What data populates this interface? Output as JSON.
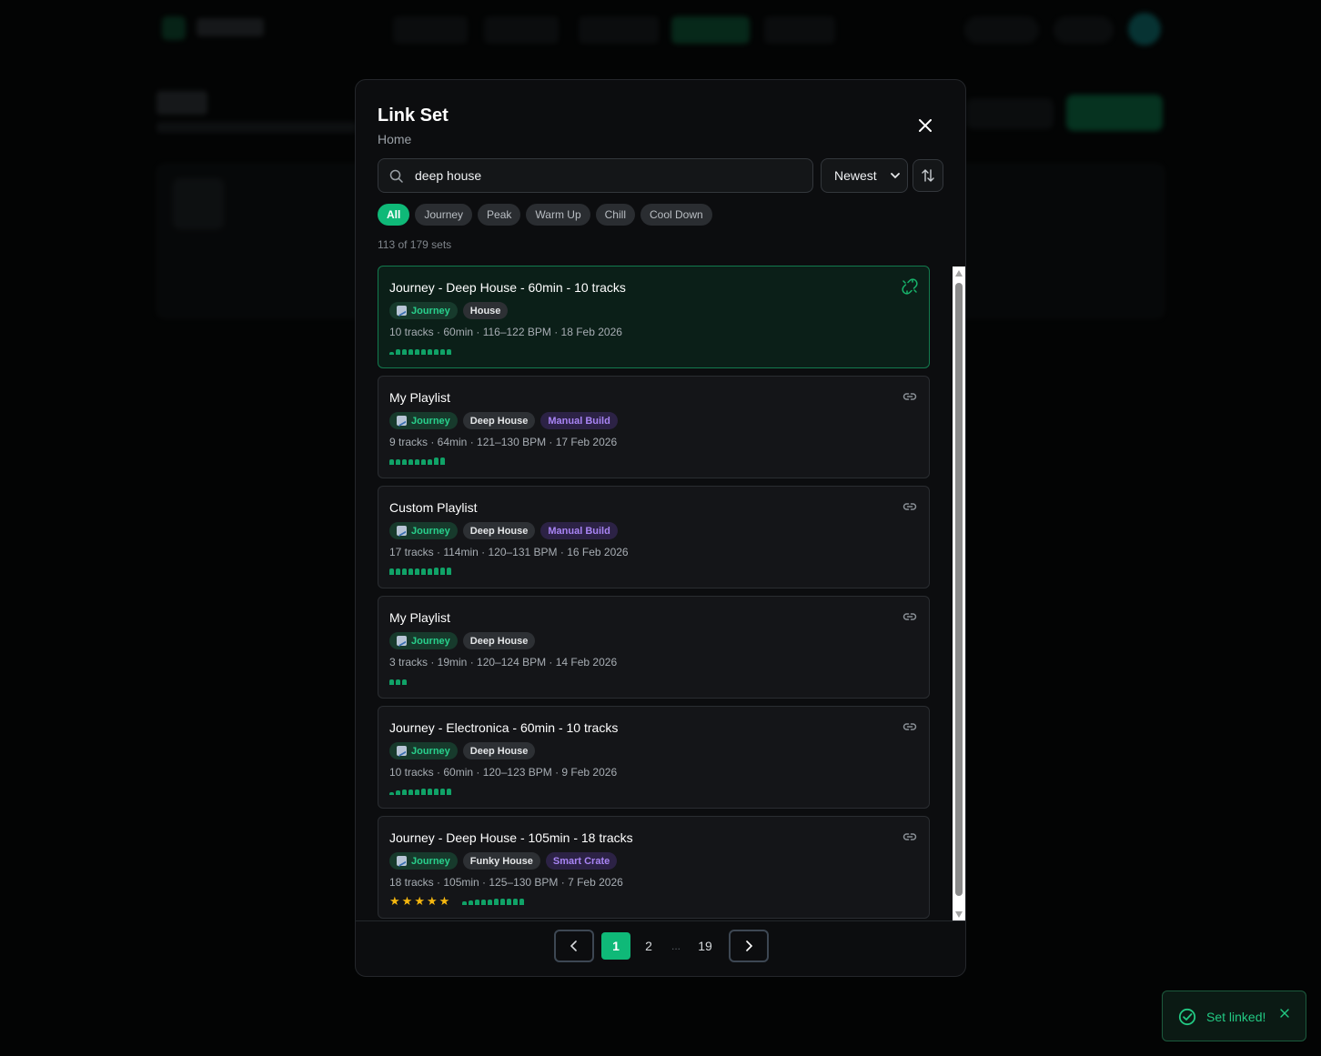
{
  "modal": {
    "title": "Link Set",
    "subtitle": "Home",
    "search": {
      "value": "deep house",
      "placeholder": ""
    },
    "sort": {
      "selected": "Newest"
    },
    "filters": [
      {
        "label": "All",
        "active": true
      },
      {
        "label": "Journey",
        "active": false
      },
      {
        "label": "Peak",
        "active": false
      },
      {
        "label": "Warm Up",
        "active": false
      },
      {
        "label": "Chill",
        "active": false
      },
      {
        "label": "Cool Down",
        "active": false
      }
    ],
    "count_text": "113 of 179 sets",
    "sets": [
      {
        "title": "Journey - Deep House - 60min - 10 tracks",
        "linked": true,
        "tags": [
          {
            "label": "Journey",
            "kind": "journey"
          },
          {
            "label": "House",
            "kind": "genre"
          }
        ],
        "meta": "10 tracks · 60min · 116–122 BPM · 18 Feb 2026",
        "energy": [
          0.3,
          0.6,
          0.6,
          0.6,
          0.6,
          0.6,
          0.6,
          0.6,
          0.6,
          0.6
        ],
        "rating": 0
      },
      {
        "title": "My Playlist",
        "linked": false,
        "tags": [
          {
            "label": "Journey",
            "kind": "journey"
          },
          {
            "label": "Deep House",
            "kind": "genre"
          },
          {
            "label": "Manual Build",
            "kind": "manual"
          }
        ],
        "meta": "9 tracks · 64min · 121–130 BPM · 17 Feb 2026",
        "energy": [
          0.6,
          0.6,
          0.6,
          0.6,
          0.6,
          0.6,
          0.6,
          0.8,
          0.8
        ],
        "rating": 0
      },
      {
        "title": "Custom Playlist",
        "linked": false,
        "tags": [
          {
            "label": "Journey",
            "kind": "journey"
          },
          {
            "label": "Deep House",
            "kind": "genre"
          },
          {
            "label": "Manual Build",
            "kind": "manual"
          }
        ],
        "meta": "17 tracks · 114min · 120–131 BPM · 16 Feb 2026",
        "energy": [
          0.7,
          0.7,
          0.7,
          0.7,
          0.7,
          0.7,
          0.7,
          0.8,
          0.8,
          0.8
        ],
        "rating": 0
      },
      {
        "title": "My Playlist",
        "linked": false,
        "tags": [
          {
            "label": "Journey",
            "kind": "journey"
          },
          {
            "label": "Deep House",
            "kind": "genre"
          }
        ],
        "meta": "3 tracks · 19min · 120–124 BPM · 14 Feb 2026",
        "energy": [
          0.6,
          0.6,
          0.6
        ],
        "rating": 0
      },
      {
        "title": "Journey - Electronica - 60min - 10 tracks",
        "linked": false,
        "tags": [
          {
            "label": "Journey",
            "kind": "journey"
          },
          {
            "label": "Deep House",
            "kind": "genre"
          }
        ],
        "meta": "10 tracks · 60min · 120–123 BPM · 9 Feb 2026",
        "energy": [
          0.3,
          0.5,
          0.6,
          0.6,
          0.6,
          0.7,
          0.7,
          0.7,
          0.7,
          0.7
        ],
        "rating": 0
      },
      {
        "title": "Journey - Deep House - 105min - 18 tracks",
        "linked": false,
        "tags": [
          {
            "label": "Journey",
            "kind": "journey"
          },
          {
            "label": "Funky House",
            "kind": "genre"
          },
          {
            "label": "Smart Crate",
            "kind": "smart"
          }
        ],
        "meta": "18 tracks · 105min · 125–130 BPM · 7 Feb 2026",
        "energy": [
          0.4,
          0.5,
          0.6,
          0.6,
          0.6,
          0.7,
          0.7,
          0.7,
          0.7,
          0.7
        ],
        "rating": 5
      }
    ],
    "pagination": {
      "pages": [
        "1",
        "2",
        "...",
        "19"
      ],
      "current": "1"
    }
  },
  "toast": {
    "text": "Set linked!"
  },
  "colors": {
    "accent": "#0fb978",
    "journey": "#28d08c",
    "manual": "#a884f4",
    "star": "#f5b70f"
  }
}
